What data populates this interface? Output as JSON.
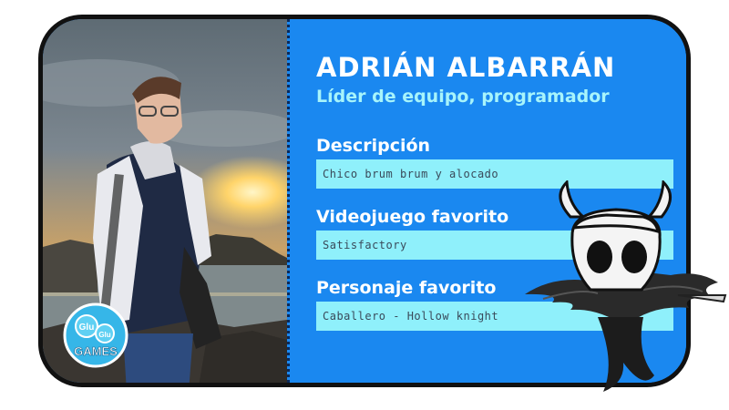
{
  "profile": {
    "name": "ADRIÁN ALBARRÁN",
    "role": "Líder de equipo, programador"
  },
  "fields": [
    {
      "label": "Descripción",
      "value": "Chico brum brum y alocado"
    },
    {
      "label": "Videojuego favorito",
      "value": "Satisfactory"
    },
    {
      "label": "Personaje favorito",
      "value": "Caballero - Hollow knight"
    }
  ],
  "logo": {
    "line1": "Glu",
    "line2": "Glu",
    "line3": "GAMES"
  },
  "colors": {
    "panel_blue": "#1a88f0",
    "field_cyan": "#8ff0fb",
    "role_cyan": "#a7f4fb",
    "border": "#111111"
  },
  "icons": {
    "logo": "glu-glu-games-logo",
    "character": "hollow-knight-character"
  }
}
